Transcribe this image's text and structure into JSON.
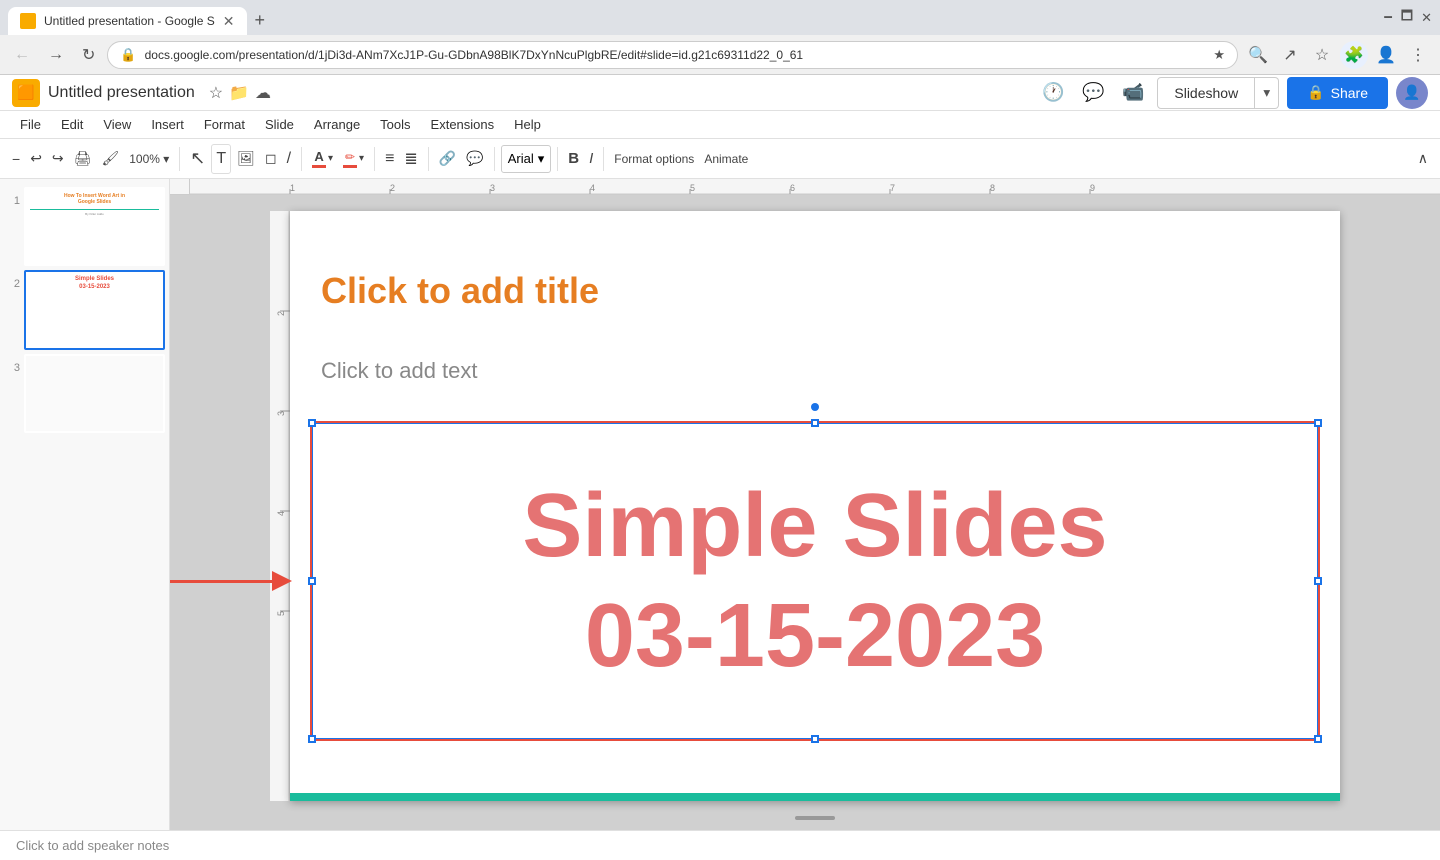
{
  "browser": {
    "tab_title": "Untitled presentation - Google S",
    "url": "docs.google.com/presentation/d/1jDi3d-ANm7XcJ1P-Gu-GDbnA98BlK7DxYnNcuPlgbRE/edit#slide=id.g21c69311d22_0_61",
    "new_tab_label": "+"
  },
  "app": {
    "logo_letter": "P",
    "title": "Untitled presentation",
    "star_icon": "★",
    "drive_icon": "⬡",
    "cloud_icon": "☁"
  },
  "header": {
    "history_icon": "🕐",
    "comment_icon": "💬",
    "video_icon": "📹",
    "slideshow_label": "Slideshow",
    "share_label": "Share",
    "lock_icon": "🔒"
  },
  "menu": {
    "items": [
      "File",
      "Edit",
      "View",
      "Insert",
      "Format",
      "Slide",
      "Arrange",
      "Tools",
      "Extensions",
      "Help"
    ]
  },
  "toolbar": {
    "zoom_icon": "−",
    "undo_icon": "↩",
    "redo_icon": "↪",
    "print_icon": "🖨",
    "format_paint_icon": "🖌",
    "zoom_level": "▼",
    "select_icon": "↖",
    "text_icon": "T",
    "image_icon": "🖼",
    "shape_icon": "◻",
    "line_icon": "/",
    "font_color_letter": "A",
    "font_color_bg": "#e74c3c",
    "highlight_color": "#e74c3c",
    "align_left": "≡",
    "align_justify": "≣",
    "link_icon": "🔗",
    "comment_icon": "💬",
    "format_options_label": "Format options",
    "animate_label": "Animate",
    "font_name": "Arial",
    "font_size": "▼",
    "bold_label": "B",
    "italic_label": "I",
    "expand_icon": "∧"
  },
  "slides": {
    "panel": {
      "slide1": {
        "number": "1",
        "title_line1": "How To Insert Word Art in",
        "title_line2": "Google Slides",
        "author": "By Killer Addo"
      },
      "slide2": {
        "number": "2",
        "line1": "Simple Slides",
        "line2": "03-15-2023"
      },
      "slide3": {
        "number": "3"
      }
    }
  },
  "canvas": {
    "slide_title_placeholder": "Click to add title",
    "slide_body_placeholder": "Click to add text",
    "textbox_line1": "Simple Slides",
    "textbox_line2": "03-15-2023",
    "speaker_notes": "Click to add speaker notes"
  },
  "colors": {
    "accent_orange": "#e67e22",
    "accent_red": "#e74c3c",
    "accent_teal": "#1abc9c",
    "text_red_light": "#e57373",
    "selection_blue": "#1a73e8",
    "share_blue": "#1a73e8"
  }
}
